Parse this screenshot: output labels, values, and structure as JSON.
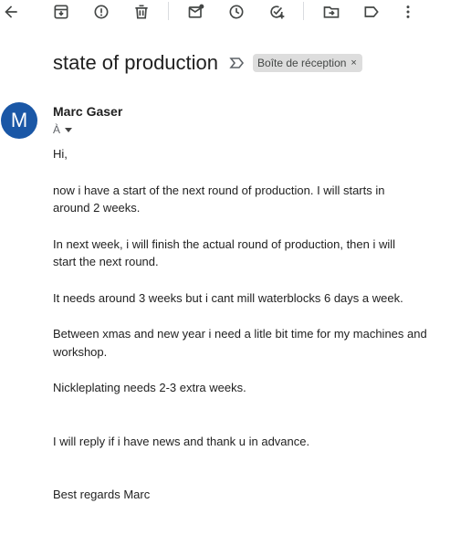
{
  "toolbar": {
    "icons": [
      "back-arrow-icon",
      "archive-icon",
      "report-spam-icon",
      "delete-icon",
      "mark-unread-icon",
      "snooze-icon",
      "add-to-tasks-icon",
      "move-to-icon",
      "label-icon",
      "more-options-icon"
    ]
  },
  "email": {
    "subject": "state of production",
    "label": "Boîte de réception",
    "label_remove": "×",
    "sender_initial": "M",
    "sender_name": "Marc Gaser",
    "to": "À",
    "avatar_color": "#1a57a6",
    "body": {
      "greeting": "Hi,",
      "p1_line1": "now i have a start of the next round of production. I will starts in",
      "p1_line2": "around 2 weeks.",
      "p2_line1": "In next week, i will finish the actual round of production, then i will",
      "p2_line2": "start the next round.",
      "p3": "It needs around 3 weeks but i cant mill waterblocks 6 days a week.",
      "p4_line1": "Between xmas and new year i need a litle bit time for my machines and",
      "p4_line2": "workshop.",
      "p5": "Nickleplating needs 2-3 extra weeks.",
      "p6": "I will reply if i have news and thank u in advance.",
      "signoff": "Best regards Marc"
    }
  }
}
